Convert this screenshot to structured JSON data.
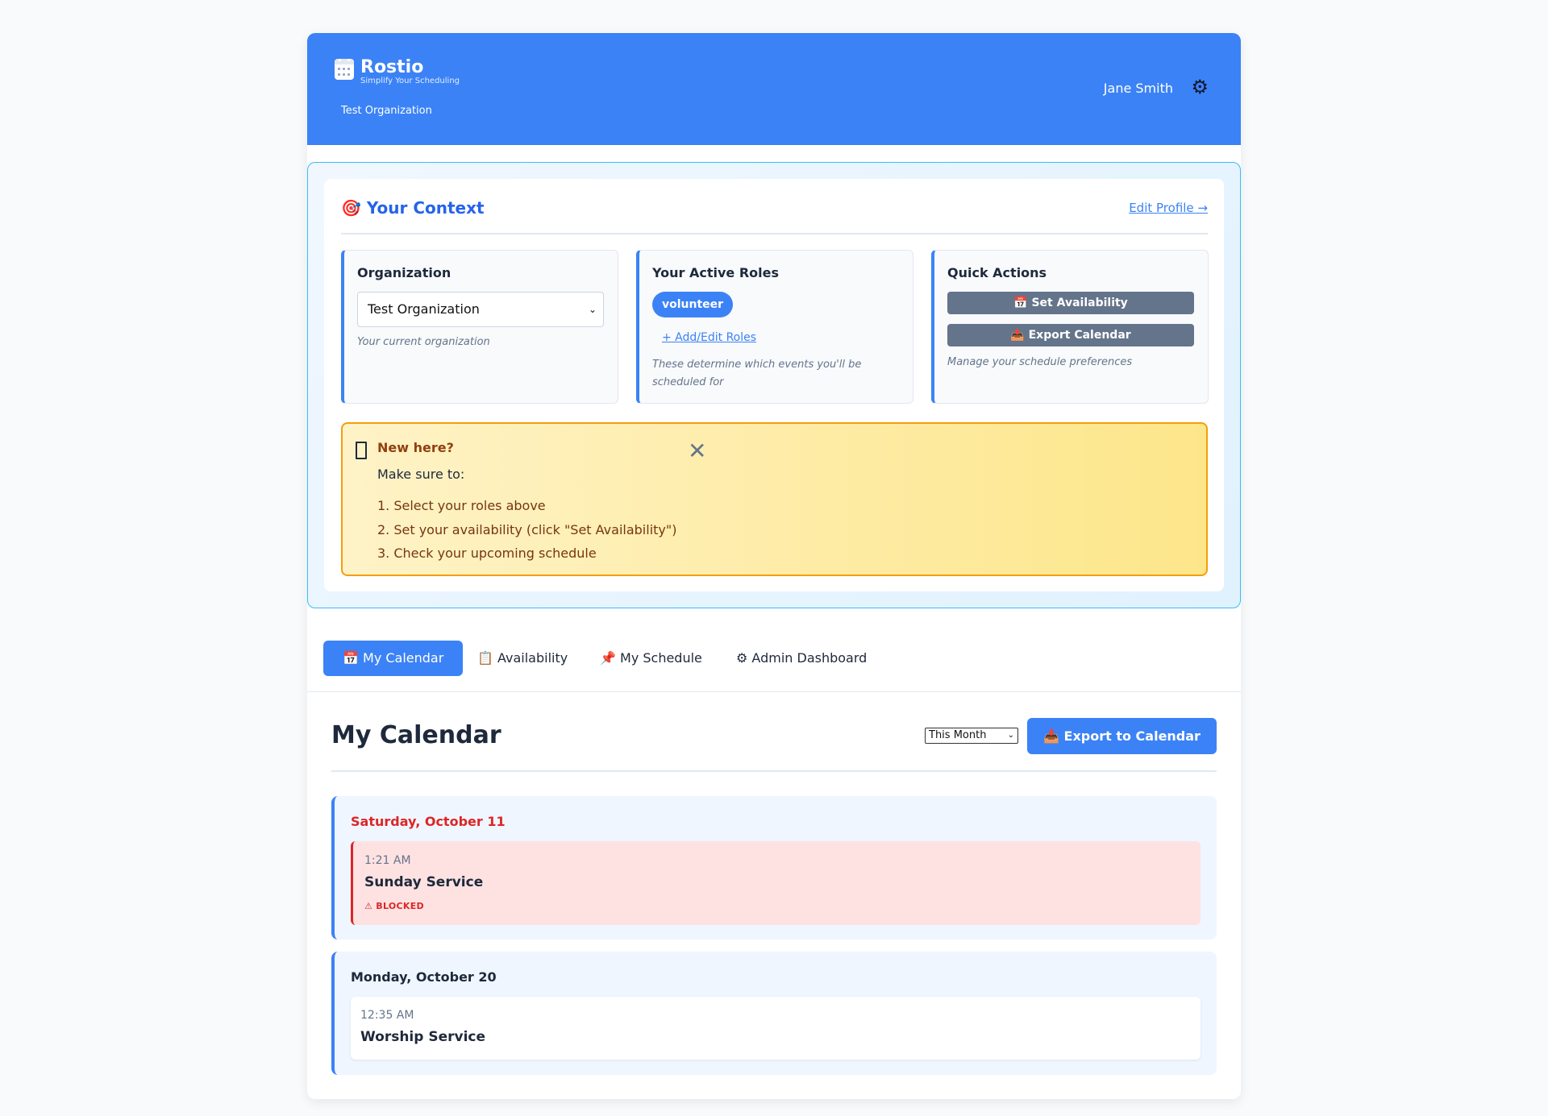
{
  "header": {
    "brand": "Rostio",
    "tagline": "Simplify Your Scheduling",
    "organization": "Test Organization",
    "user_name": "Jane Smith",
    "icons": {
      "logo": "calendar-icon",
      "settings": "gear-icon"
    }
  },
  "context": {
    "title": "🎯 Your Context",
    "edit_profile": "Edit Profile →",
    "organization_card": {
      "title": "Organization",
      "select_value": "Test Organization",
      "hint": "Your current organization"
    },
    "roles_card": {
      "title": "Your Active Roles",
      "roles": [
        "volunteer"
      ],
      "add_edit": "+ Add/Edit Roles",
      "hint": "These determine which events you'll be scheduled for"
    },
    "quick_actions": {
      "title": "Quick Actions",
      "set_availability": "📅 Set Availability",
      "export_calendar": "📤 Export Calendar",
      "hint": "Manage your schedule preferences"
    },
    "new_here": {
      "title": "New here?",
      "subtitle": "Make sure to:",
      "steps": [
        "1. Select your roles above",
        "2. Set your availability (click \"Set Availability\")",
        "3. Check your upcoming schedule"
      ],
      "close": "✕"
    }
  },
  "tabs": [
    {
      "label": "📅 My Calendar",
      "active": true
    },
    {
      "label": "📋 Availability",
      "active": false
    },
    {
      "label": "📌 My Schedule",
      "active": false
    },
    {
      "label": "⚙ Admin Dashboard",
      "active": false
    }
  ],
  "calendar": {
    "title": "My Calendar",
    "range": "This Month",
    "export_button": "📥 Export to Calendar",
    "days": [
      {
        "date": "Saturday, October 11",
        "date_color": "#dc2626",
        "events": [
          {
            "time": "1:21 AM",
            "name": "Sunday Service",
            "status": "⚠ BLOCKED",
            "blocked": true
          }
        ]
      },
      {
        "date": "Monday, October 20",
        "date_color": "#1e293b",
        "events": [
          {
            "time": "12:35 AM",
            "name": "Worship Service",
            "status": "",
            "blocked": false
          }
        ]
      }
    ]
  },
  "colors": {
    "accent": "#3b82f6",
    "blocked_bg": "#fee2e2",
    "blocked_border": "#dc2626",
    "warning_border": "#f59e0b"
  }
}
